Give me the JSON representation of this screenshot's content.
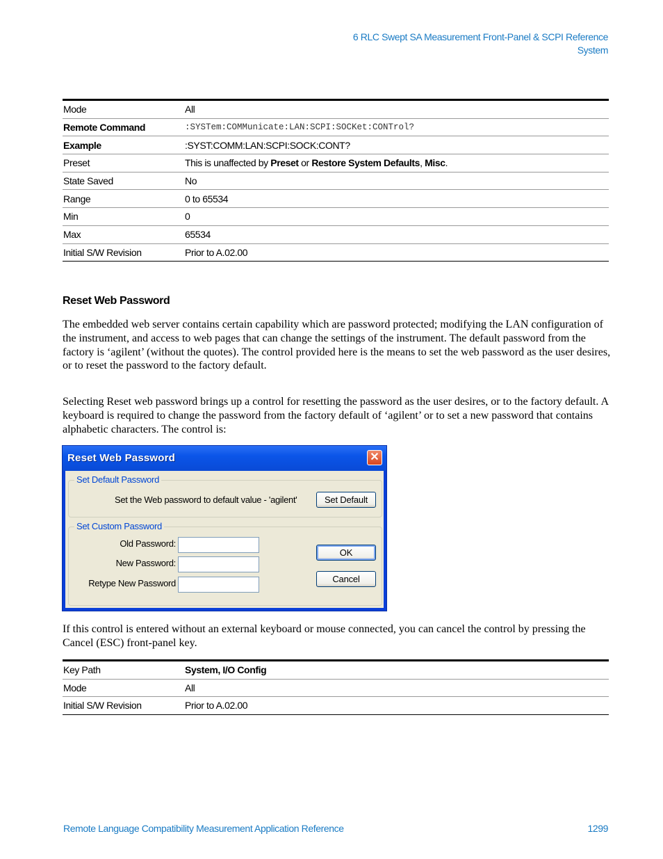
{
  "header": {
    "chapter": "6  RLC Swept SA Measurement Front-Panel & SCPI Reference",
    "section": "System"
  },
  "table1": {
    "rows": [
      {
        "key": "Mode",
        "value": "All"
      },
      {
        "key": "Remote Command",
        "value": ":SYSTem:COMMunicate:LAN:SCPI:SOCKet:CONTrol?"
      },
      {
        "key": "Example",
        "value": ":SYST:COMM:LAN:SCPI:SOCK:CONT?"
      },
      {
        "key": "Preset",
        "value_parts": [
          "This is unaffected by ",
          "Preset",
          " or ",
          "Restore System Defaults",
          ", ",
          "Misc",
          "."
        ]
      },
      {
        "key": "State Saved",
        "value": "No"
      },
      {
        "key": "Range",
        "value": "0 to 65534"
      },
      {
        "key": "Min",
        "value": "0"
      },
      {
        "key": "Max",
        "value": "65534"
      },
      {
        "key": "Initial S/W Revision",
        "value": "Prior to A.02.00"
      }
    ]
  },
  "section": {
    "title": "Reset Web Password",
    "paragraph1": "The embedded web server contains certain capability which are password protected; modifying the LAN configuration of the instrument, and access to web pages that can change the settings of the instrument. The default password from the factory is ‘agilent’ (without the quotes). The control provided here is the means to set the web password as the user desires, or to reset the password to the factory default.",
    "paragraph2": "Selecting Reset web password brings up a control for resetting the password as the user desires, or to the factory default. A keyboard is required to change the password from the factory default of ‘agilent’ or to set a new password that contains alphabetic characters. The control is:",
    "paragraph3": "If this control is entered without an external keyboard or mouse connected, you can cancel the control by pressing the Cancel (ESC) front-panel key."
  },
  "dialog": {
    "title": "Reset Web Password",
    "close_icon": "close-icon",
    "default_group": {
      "legend": "Set Default Password",
      "description": "Set the Web password to default value - 'agilent'",
      "button": "Set Default"
    },
    "custom_group": {
      "legend": "Set Custom Password",
      "old_label": "Old Password:",
      "old_value": "",
      "new_label": "New Password:",
      "new_value": "",
      "retype_label": "Retype New Password",
      "retype_value": ""
    },
    "ok_button": "OK",
    "cancel_button": "Cancel"
  },
  "table2": {
    "rows": [
      {
        "key": "Key Path",
        "value": "System, I/O Config"
      },
      {
        "key": "Mode",
        "value": "All"
      },
      {
        "key": "Initial S/W Revision",
        "value": "Prior to A.02.00"
      }
    ]
  },
  "footer": {
    "title": "Remote Language Compatibility Measurement Application Reference",
    "page": "1299"
  }
}
